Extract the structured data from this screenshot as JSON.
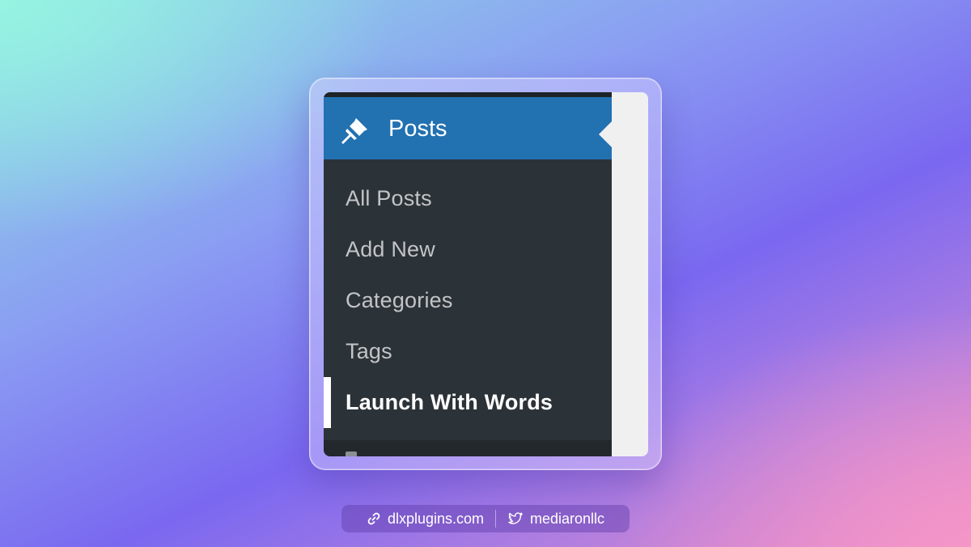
{
  "menu": {
    "header_label": "Posts",
    "header_icon": "pushpin-icon",
    "items": [
      {
        "label": "All Posts",
        "active": false
      },
      {
        "label": "Add New",
        "active": false
      },
      {
        "label": "Categories",
        "active": false
      },
      {
        "label": "Tags",
        "active": false
      },
      {
        "label": "Launch With Words",
        "active": true
      }
    ]
  },
  "footer": {
    "website": "dlxplugins.com",
    "website_icon": "link-icon",
    "twitter": "mediaronllc",
    "twitter_icon": "twitter-bird-icon"
  },
  "colors": {
    "menu_header_bg": "#2271b1",
    "menu_bg": "#2c3338",
    "menu_text": "#c3c4c7",
    "active_text": "#ffffff",
    "content_bg": "#f0f0f1"
  }
}
